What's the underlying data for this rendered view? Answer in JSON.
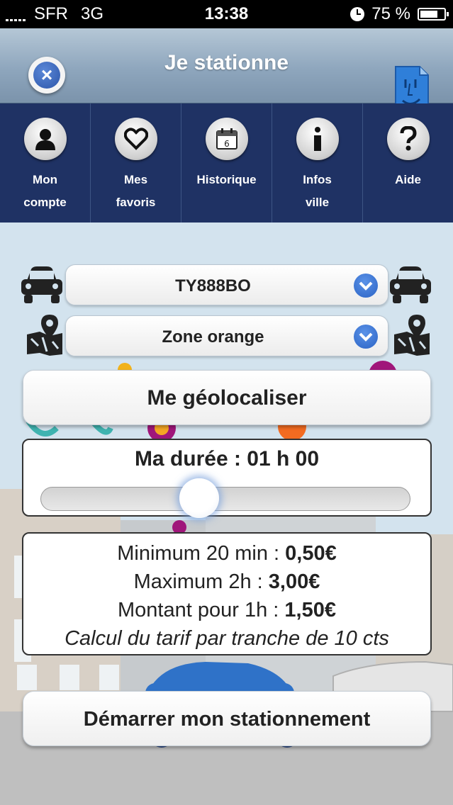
{
  "status_bar": {
    "carrier": "SFR",
    "network": "3G",
    "time": "13:38",
    "battery": "75 %"
  },
  "header": {
    "title": "Je stationne"
  },
  "nav": {
    "items": [
      {
        "label": "Mon\ncompte",
        "icon": "user-icon"
      },
      {
        "label": "Mes\nfavoris",
        "icon": "heart-icon"
      },
      {
        "label": "Historique",
        "icon": "calendar-icon"
      },
      {
        "label": "Infos\nville",
        "icon": "info-icon"
      },
      {
        "label": "Aide",
        "icon": "help-icon"
      }
    ]
  },
  "form": {
    "vehicle": "TY888BO",
    "zone": "Zone orange",
    "geolocate_label": "Me géolocaliser",
    "duration_label": "Ma durée : 01 h 00",
    "duration_fraction": 0.42
  },
  "tariff": {
    "min_label": "Minimum 20 min : ",
    "min_value": "0,50€",
    "max_label": "Maximum 2h : ",
    "max_value": "3,00€",
    "amount_label": "Montant pour 1h : ",
    "amount_value": "1,50€",
    "note": "Calcul du tarif par tranche de 10 cts"
  },
  "start_label": "Démarrer mon stationnement",
  "colors": {
    "nav_bg": "#1f3264",
    "accent_blue": "#2b63c4"
  }
}
